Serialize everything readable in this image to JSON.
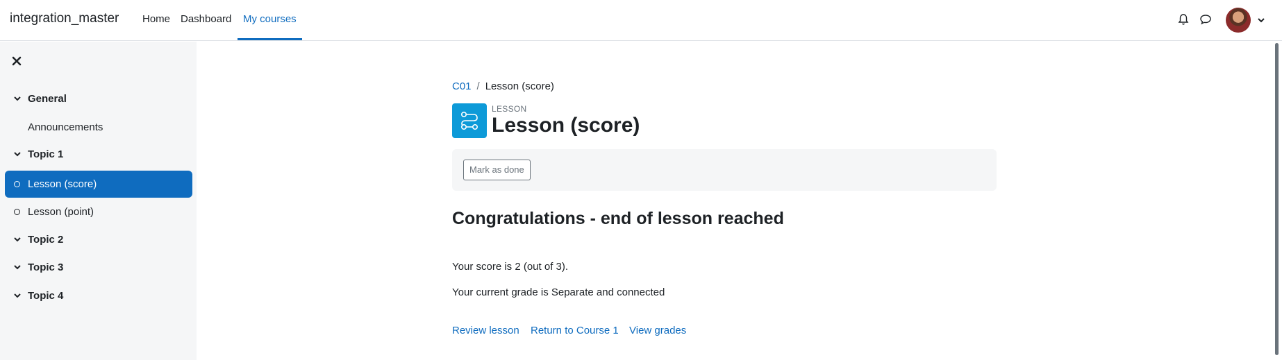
{
  "navbar": {
    "brand": "integration_master",
    "items": [
      {
        "label": "Home",
        "active": false
      },
      {
        "label": "Dashboard",
        "active": false
      },
      {
        "label": "My courses",
        "active": true
      }
    ],
    "icons": [
      "bell-icon",
      "chat-icon",
      "avatar",
      "chevron-down-icon"
    ]
  },
  "sidebar": {
    "sections": [
      {
        "label": "General",
        "items": [
          "Announcements"
        ]
      },
      {
        "label": "Topic 1",
        "items": [
          "Lesson (score)",
          "Lesson (point)"
        ]
      },
      {
        "label": "Topic 2",
        "items": []
      },
      {
        "label": "Topic 3",
        "items": []
      },
      {
        "label": "Topic 4",
        "items": []
      }
    ],
    "active_item": "Lesson (score)"
  },
  "breadcrumb": {
    "course": "C01",
    "separator": "/",
    "current": "Lesson (score)"
  },
  "activity": {
    "type": "LESSON",
    "title": "Lesson (score)",
    "icon": "lesson-icon"
  },
  "completion": {
    "button_label": "Mark as done"
  },
  "content": {
    "heading": "Congratulations - end of lesson reached",
    "score": "Your score is 2 (out of 3).",
    "grade": "Your current grade is Separate and connected"
  },
  "actions": {
    "review": "Review lesson",
    "return": "Return to Course 1",
    "grades": "View grades"
  },
  "colors": {
    "accent": "#0f6cbf",
    "activity_icon_bg": "#0d9ad8",
    "sidebar_bg": "#f5f6f7",
    "text": "#1d2125"
  }
}
